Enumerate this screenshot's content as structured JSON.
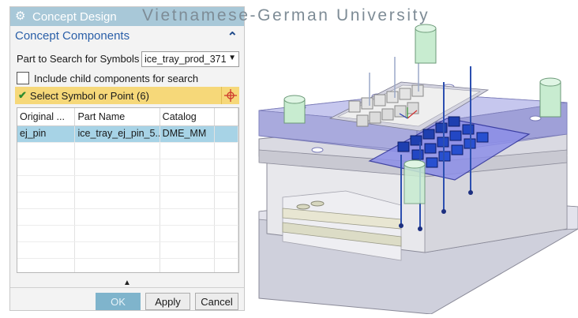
{
  "dialog": {
    "title": "Concept Design",
    "title_icon": "gear-icon",
    "section_title": "Concept Components",
    "part_label": "Part to Search for Symbols",
    "part_value": "ice_tray_prod_371",
    "include_child_label": "Include child components for search",
    "include_child_checked": false,
    "select_label": "Select Symbol or Point (6)",
    "columns": [
      "Original ...",
      "Part Name",
      "Catalog",
      ""
    ],
    "rows": [
      {
        "original": "ej_pin",
        "part_name": "ice_tray_ej_pin_5...",
        "catalog": "DME_MM",
        "selected": true
      }
    ],
    "buttons": {
      "ok": "OK",
      "apply": "Apply",
      "cancel": "Cancel"
    }
  },
  "watermark": "Vietnamese-German University",
  "colors": {
    "titlebar": "#a8c8d8",
    "selection_bar": "#f6d879",
    "selected_row": "#a7d3e6",
    "ok_button": "#7fb4cc",
    "mold_plate": "#d9d8e8",
    "top_plate": "#b5b6e6",
    "ice_tray_part": "#1e3fb0"
  }
}
